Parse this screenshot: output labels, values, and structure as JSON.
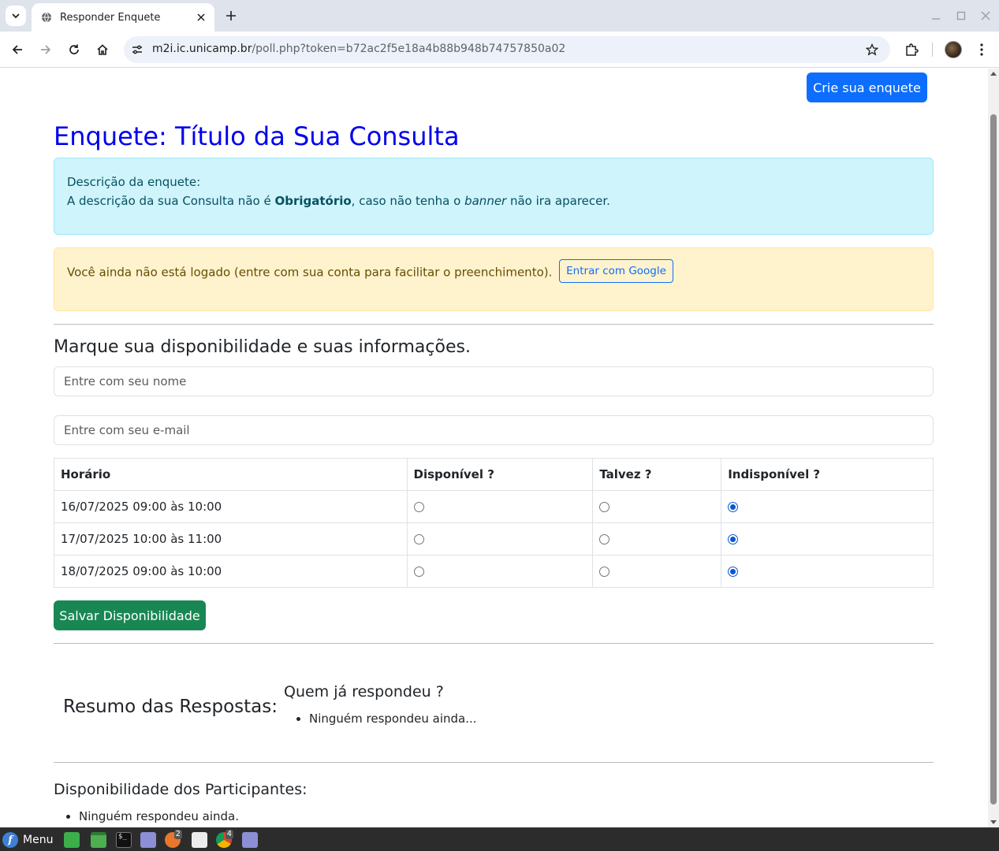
{
  "browser": {
    "tab_title": "Responder Enquete",
    "url_host": "m2i.ic.unicamp.br",
    "url_rest": "/poll.php?token=b72ac2f5e18a4b88b948b74757850a02"
  },
  "page": {
    "create_button": "Crie sua enquete",
    "title": "Enquete: Título da Sua Consulta",
    "description": {
      "label": "Descrição da enquete:",
      "prefix": "A descrição da sua Consulta não é ",
      "bold": "Obrigatório",
      "middle": ", caso não tenha o ",
      "italic": "banner",
      "suffix": " não ira aparecer."
    },
    "login_alert": {
      "text": "Você ainda não está logado (entre com sua conta para facilitar o preenchimento).",
      "google_button": "Entrar com Google"
    },
    "form": {
      "section_title": "Marque sua disponibilidade e suas informações.",
      "name_placeholder": "Entre com seu nome",
      "email_placeholder": "Entre com seu e-mail"
    },
    "table": {
      "headers": [
        "Horário",
        "Disponível ?",
        "Talvez ?",
        "Indisponível ?"
      ],
      "rows": [
        {
          "time": "16/07/2025 09:00 às 10:00",
          "selected": "indisponivel"
        },
        {
          "time": "17/07/2025 10:00 às 11:00",
          "selected": "indisponivel"
        },
        {
          "time": "18/07/2025 09:00 às 10:00",
          "selected": "indisponivel"
        }
      ]
    },
    "save_button": "Salvar Disponibilidade",
    "summary": {
      "title": "Resumo das Respostas:",
      "who_title": "Quem já respondeu ?",
      "who_empty": "Ninguém respondeu ainda..."
    },
    "participants": {
      "title": "Disponibilidade dos Participantes:",
      "empty": "Ninguém respondeu ainda."
    }
  },
  "taskbar": {
    "menu_label": "Menu",
    "badges": [
      "2",
      "4"
    ]
  },
  "colors": {
    "title_blue": "#0000ee",
    "primary": "#0d6efd",
    "success": "#198754",
    "info_bg": "#cff4fc",
    "warning_bg": "#fff3cd"
  }
}
